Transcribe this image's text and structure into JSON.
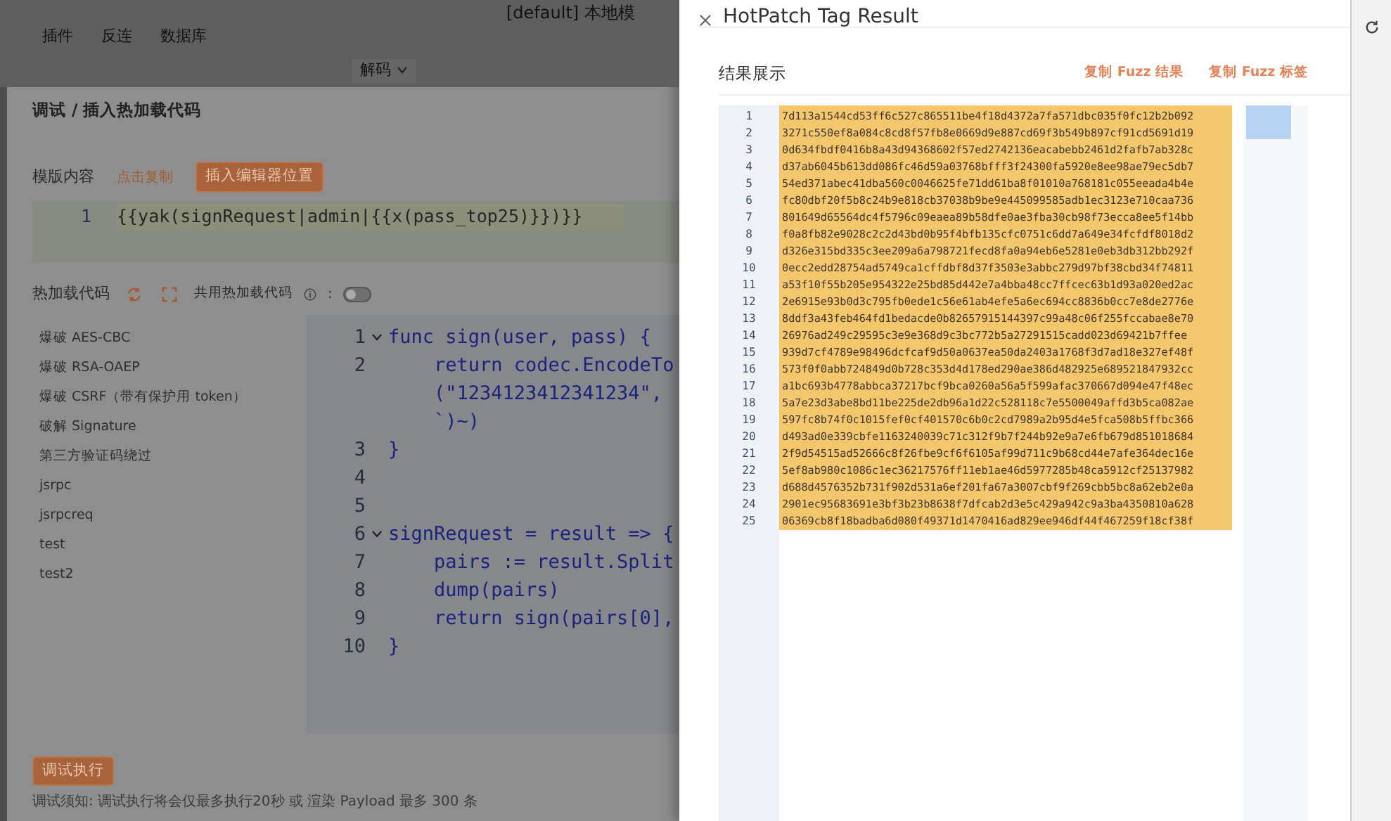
{
  "app": {
    "title": "[default] 本地模",
    "menu": [
      "插件",
      "反连",
      "数据库"
    ],
    "decode_dropdown": "解码"
  },
  "debug_modal": {
    "title": "调试 / 插入热加载代码",
    "template_label": "模版内容",
    "copy_link": "点击复制",
    "insert_button": "插入编辑器位置",
    "template_code": {
      "line_number": "1",
      "code": "{{yak(signRequest|admin|{{x(pass_top25)}})}}"
    },
    "hotload_label": "热加载代码",
    "share_label": "共用热加载代码",
    "share_suffix": ":",
    "share_toggle": {
      "on": false
    },
    "templates": [
      "爆破 AES-CBC",
      "爆破 RSA-OAEP",
      "爆破 CSRF（带有保护用 token）",
      "破解 Signature",
      "第三方验证码绕过",
      "jsrpc",
      "jsrpcreq",
      "test",
      "test2"
    ],
    "editor_lines": [
      {
        "number": "1",
        "fold": true,
        "text": "func sign(user, pass) {"
      },
      {
        "number": "2",
        "fold": false,
        "text": "    return codec.EncodeTo"
      },
      {
        "fold": false,
        "text": "    (\"1234123412341234\","
      },
      {
        "fold": false,
        "text": "    `)~)"
      },
      {
        "number": "3",
        "fold": false,
        "text": "}"
      },
      {
        "number": "4",
        "fold": false
      },
      {
        "number": "5",
        "fold": false
      },
      {
        "number": "6",
        "fold": true,
        "text": "signRequest = result => {"
      },
      {
        "number": "7",
        "fold": false,
        "text": "    pairs := result.Split"
      },
      {
        "number": "8",
        "fold": false,
        "text": "    dump(pairs)"
      },
      {
        "number": "9",
        "fold": false,
        "text": "    return sign(pairs[0],"
      },
      {
        "number": "10",
        "fold": false,
        "text": "}"
      }
    ],
    "run_button": "调试执行",
    "note": "调试须知: 调试执行将会仅最多执行20秒 或 渲染 Payload 最多 300 条"
  },
  "result_drawer": {
    "title": "HotPatch Tag Result",
    "section_title": "结果展示",
    "actions": [
      "复制 Fuzz 结果",
      "复制 Fuzz 标签"
    ],
    "lines": [
      {
        "number": "1",
        "text": "7d113a1544cd53ff6c527c865511be4f18d4372a7fa571dbc035f0fc12b2b092"
      },
      {
        "number": "2",
        "text": "3271c550ef8a084c8cd8f57fb8e0669d9e887cd69f3b549b897cf91cd5691d19"
      },
      {
        "number": "3",
        "text": "0d634fbdf0416b8a43d94368602f57ed2742136eacabebb2461d2fafb7ab328c"
      },
      {
        "number": "4",
        "text": "d37ab6045b613dd086fc46d59a03768bfff3f24300fa5920e8ee98ae79ec5db7"
      },
      {
        "number": "5",
        "text": "54ed371abec41dba560c0046625fe71dd61ba8f01010a768181c055eeada4b4e"
      },
      {
        "number": "6",
        "text": "fc80dbf20f5b8c24b9e818cb37038b9be9e445099585adb1ec3123e710caa736"
      },
      {
        "number": "7",
        "text": "801649d65564dc4f5796c09eaea89b58dfe0ae3fba30cb98f73ecca8ee5f14bb"
      },
      {
        "number": "8",
        "text": "f0a8fb82e9028c2c2d43bd0b95f4bfb135cfc0751c6dd7a649e34fcfdf8018d2"
      },
      {
        "number": "9",
        "text": "d326e315bd335c3ee209a6a798721fecd8fa0a94eb6e5281e0eb3db312bb292f"
      },
      {
        "number": "10",
        "text": "0ecc2edd28754ad5749ca1cffdbf8d37f3503e3abbc279d97bf38cbd34f74811"
      },
      {
        "number": "11",
        "text": "a53f10f55b205e954322e25bd85d442e7a4bba48cc7ffcec63b1d93a020ed2ac"
      },
      {
        "number": "12",
        "text": "2e6915e93b0d3c795fb0ede1c56e61ab4efe5a6ec694cc8836b0cc7e8de2776e"
      },
      {
        "number": "13",
        "text": "8ddf3a43feb464fd1bedacde0b82657915144397c99a48c06f255fccabae8e70"
      },
      {
        "number": "14",
        "text": "26976ad249c29595c3e9e368d9c3bc772b5a27291515cadd023d69421b7ffee"
      },
      {
        "number": "15",
        "text": "939d7cf4789e98496dcfcaf9d50a0637ea50da2403a1768f3d7ad18e327ef48f"
      },
      {
        "number": "16",
        "text": "573f0f0abb724849d0b728c353d4d178ed290ae386d482925e689521847932cc"
      },
      {
        "number": "17",
        "text": "a1bc693b4778abbca37217bcf9bca0260a56a5f599afac370667d094e47f48ec"
      },
      {
        "number": "18",
        "text": "5a7e23d3abe8bd11be225de2db96a1d22c528118c7e5500049affd3b5ca082ae"
      },
      {
        "number": "19",
        "text": "597fc8b74f0c1015fef0cf401570c6b0c2cd7989a2b95d4e5fca508b5ffbc366"
      },
      {
        "number": "20",
        "text": "d493ad0e339cbfe1163240039c71c312f9b7f244b92e9a7e6fb679d851018684"
      },
      {
        "number": "21",
        "text": "2f9d54515ad52666c8f26fbe9cf6f6105af99d711c9b68cd44e7afe364dec16e"
      },
      {
        "number": "22",
        "text": "5ef8ab980c1086c1ec36217576ff11eb1ae46d5977285b48ca5912cf25137982"
      },
      {
        "number": "23",
        "text": "d688d4576352b731f902d531a6ef201fa67a3007cbf9f269cbb5bc8a62eb2e0a"
      },
      {
        "number": "24",
        "text": "2901ec95683691e3bf3b23b8638f7dfcab2d3e5c429a942c9a3ba4350810a628"
      },
      {
        "number": "25",
        "text": "06369cb8f18badba6d080f49371d1470416ad829ee946df44f467259f18cf38f"
      }
    ]
  }
}
